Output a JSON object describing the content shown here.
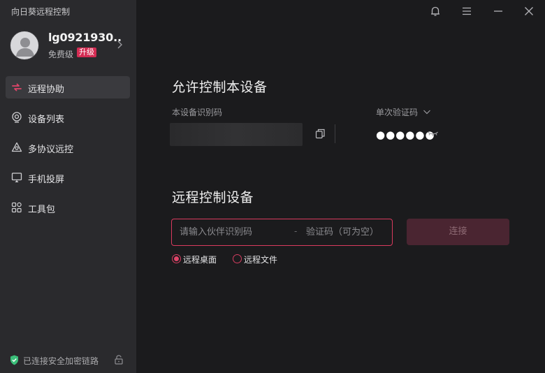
{
  "app": {
    "title": "向日葵远程控制"
  },
  "profile": {
    "username": "lg0921930...",
    "tier": "免费级",
    "upgrade_label": "升级"
  },
  "sidebar": {
    "items": [
      {
        "label": "远程协助",
        "icon": "remote-assist-icon",
        "active": true
      },
      {
        "label": "设备列表",
        "icon": "device-list-icon",
        "active": false
      },
      {
        "label": "多协议远控",
        "icon": "multi-protocol-icon",
        "active": false
      },
      {
        "label": "手机投屏",
        "icon": "screen-cast-icon",
        "active": false
      },
      {
        "label": "工具包",
        "icon": "toolbox-icon",
        "active": false
      }
    ],
    "footer_text": "已连接安全加密链路"
  },
  "allow_control": {
    "title": "允许控制本设备",
    "device_code_label": "本设备识别码",
    "verify_label": "单次验证码",
    "password_masked": "●●●●●●"
  },
  "remote_control": {
    "title": "远程控制设备",
    "partner_placeholder": "请输入伙伴识别码",
    "separator": "-",
    "code_placeholder": "验证码（可为空）",
    "connect_label": "连接",
    "modes": [
      {
        "label": "远程桌面",
        "checked": true
      },
      {
        "label": "远程文件",
        "checked": false
      }
    ]
  },
  "colors": {
    "accent": "#e0456a",
    "sidebar_bg": "#2a2a2d",
    "main_bg": "#1b1b1d",
    "connect_disabled": "#4a2531",
    "shield_green": "#3bbf7a"
  }
}
